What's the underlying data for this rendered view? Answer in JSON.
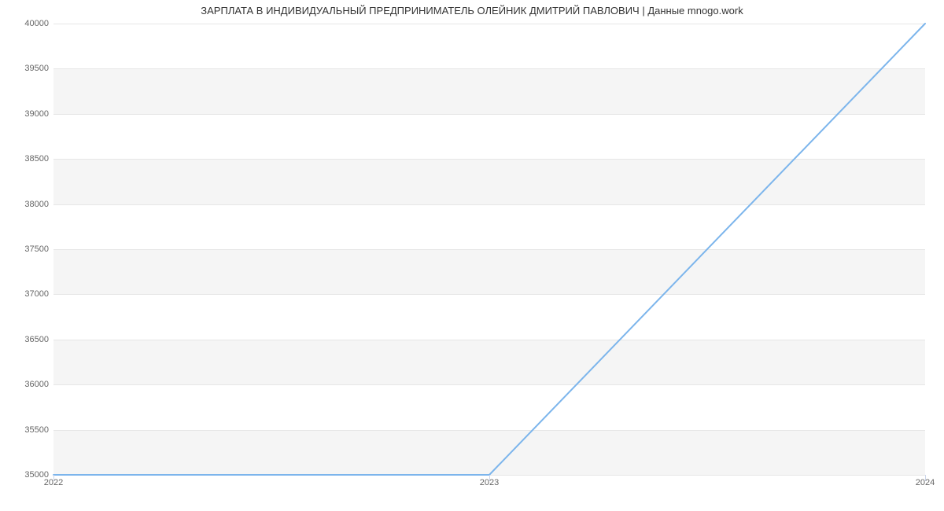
{
  "chart_data": {
    "type": "line",
    "title": "ЗАРПЛАТА В ИНДИВИДУАЛЬНЫЙ ПРЕДПРИНИМАТЕЛЬ ОЛЕЙНИК ДМИТРИЙ ПАВЛОВИЧ | Данные mnogo.work",
    "x": [
      2022,
      2023,
      2024
    ],
    "values": [
      35000,
      35000,
      40000
    ],
    "xlabel": "",
    "ylabel": "",
    "xlim": [
      2022,
      2024
    ],
    "ylim": [
      35000,
      40000
    ],
    "x_ticks": [
      2022,
      2023,
      2024
    ],
    "y_ticks": [
      35000,
      35500,
      36000,
      36500,
      37000,
      37500,
      38000,
      38500,
      39000,
      39500,
      40000
    ],
    "line_color": "#7cb5ec",
    "band_color": "#f5f5f5",
    "grid": true
  }
}
